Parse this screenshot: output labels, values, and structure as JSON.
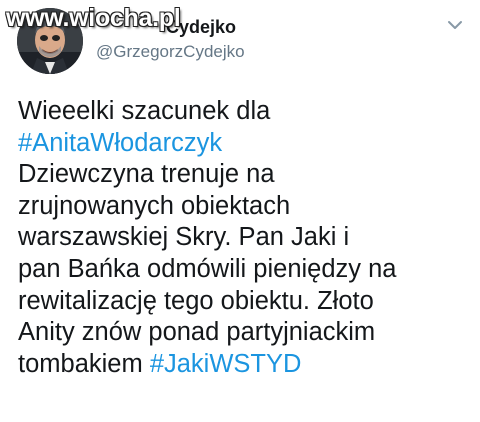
{
  "author": {
    "display_name_partial": "Cydejko",
    "handle": "@GrzegorzCydejko"
  },
  "watermark": {
    "text": "www.wiocha.pl"
  },
  "tweet": {
    "line1": "Wieeelki szacunek dla",
    "hashtag1": "#AnitaWłodarczyk",
    "line3": "Dziewczyna trenuje na",
    "line4": "zrujnowanych obiektach",
    "line5": "warszawskiej Skry. Pan Jaki i",
    "line6": "pan Bańka odmówili pieniędzy na",
    "line7": "rewitalizację tego obiektu. Złoto",
    "line8": "Anity znów ponad partyjniackim",
    "line9_text": "tombakiem",
    "hashtag2": "#JakiWSTYD"
  },
  "icons": {
    "menu": "chevron-down-icon"
  },
  "colors": {
    "text": "#14171a",
    "secondary_text": "#657786",
    "link": "#1b95e0",
    "background": "#ffffff"
  }
}
